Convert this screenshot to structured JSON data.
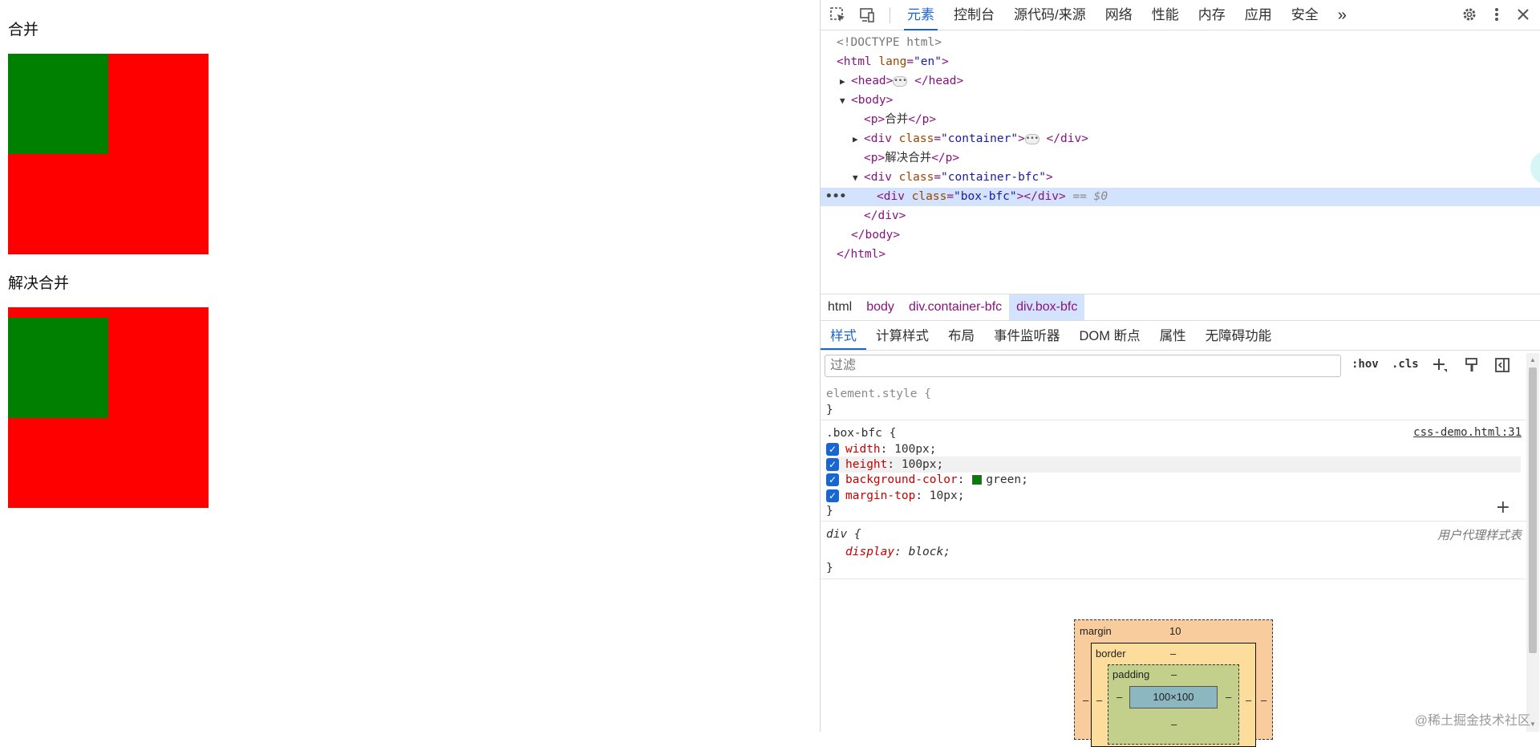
{
  "page": {
    "heading_merge": "合并",
    "heading_unmerge": "解决合并"
  },
  "toolbar": {
    "tabs": [
      "元素",
      "控制台",
      "源代码/来源",
      "网络",
      "性能",
      "内存",
      "应用",
      "安全"
    ],
    "more": "»"
  },
  "dom": {
    "doctype": "<!DOCTYPE html>",
    "html_open_tag": "<html",
    "lang_attr": "lang",
    "lang_val": "\"en\"",
    "gt": ">",
    "head_open": "<head>",
    "head_close": "</head>",
    "body_open": "<body>",
    "p_open": "<p>",
    "p1_text": "合并",
    "p_close": "</p>",
    "div_open": "<div",
    "class_attr": "class",
    "container_val": "\"container\"",
    "div_close": "</div>",
    "p2_text": "解决合并",
    "container_bfc_val": "\"container-bfc\"",
    "box_bfc_val": "\"box-bfc\"",
    "selected_marker": "== $0",
    "body_close": "</body>",
    "html_close": "</html>"
  },
  "breadcrumbs": [
    "html",
    "body",
    "div.container-bfc",
    "div.box-bfc"
  ],
  "subtabs": [
    "样式",
    "计算样式",
    "布局",
    "事件监听器",
    "DOM 断点",
    "属性",
    "无障碍功能"
  ],
  "filter": {
    "placeholder": "过滤",
    "hov": ":hov",
    "cls": ".cls"
  },
  "styles": {
    "element_style_selector": "element.style {",
    "close_brace": "}",
    "rule_selector": ".box-bfc {",
    "rule_source": "css-demo.html:31",
    "props": [
      {
        "name": "width",
        "value": "100px;"
      },
      {
        "name": "height",
        "value": "100px;"
      },
      {
        "name": "background-color",
        "value": "green;"
      },
      {
        "name": "margin-top",
        "value": "10px;"
      }
    ],
    "ua_selector": "div {",
    "ua_source": "用户代理样式表",
    "ua_prop": "display",
    "ua_value": "block;",
    "swatch_color": "#008000"
  },
  "box_model": {
    "margin_label": "margin",
    "margin_top": "10",
    "border_label": "border",
    "border_top": "–",
    "padding_label": "padding",
    "padding_top": "–",
    "content_size": "100×100",
    "dash": "–"
  },
  "watermark": "@稀土掘金技术社区",
  "colors": {
    "outer_box": "#ff0000",
    "inner_box": "#008000",
    "accent": "#1a66d1"
  }
}
